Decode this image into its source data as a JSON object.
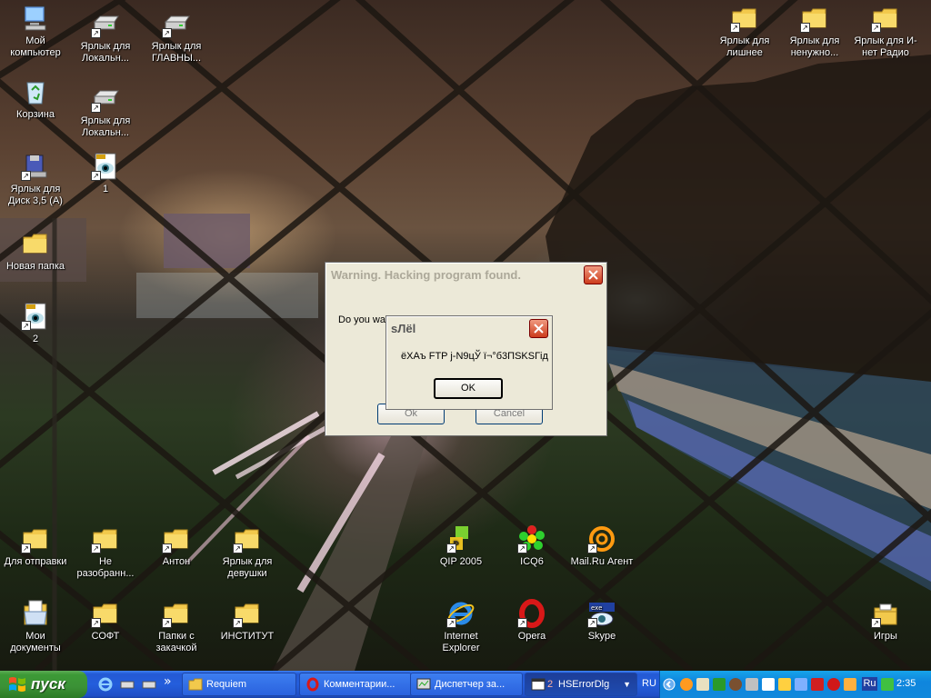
{
  "desktop": {
    "icons": [
      {
        "id": "my-computer",
        "label": "Мой компьютер",
        "icon": "my-computer-icon"
      },
      {
        "id": "local-shortcut-1",
        "label": "Ярлык для Локальн...",
        "icon": "drive-icon"
      },
      {
        "id": "main-shortcut",
        "label": "Ярлык для ГЛАВНЫ...",
        "icon": "drive-icon"
      },
      {
        "id": "recycle-bin",
        "label": "Корзина",
        "icon": "recycle-bin-icon"
      },
      {
        "id": "local-shortcut-2",
        "label": "Ярлык для Локальн...",
        "icon": "drive-icon"
      },
      {
        "id": "floppy-shortcut",
        "label": "Ярлык для Диск 3,5 (A)",
        "icon": "floppy-icon"
      },
      {
        "id": "image-1",
        "label": "1",
        "icon": "image-file-icon"
      },
      {
        "id": "new-folder",
        "label": "Новая папка",
        "icon": "folder-icon"
      },
      {
        "id": "image-2",
        "label": "2",
        "icon": "image-file-icon"
      },
      {
        "id": "shortcut-extra",
        "label": "Ярлык для лишнее",
        "icon": "folder-icon"
      },
      {
        "id": "shortcut-unneeded",
        "label": "Ярлык для ненужно...",
        "icon": "folder-icon"
      },
      {
        "id": "shortcut-radio",
        "label": "Ярлык для И-нет Радио",
        "icon": "folder-icon"
      },
      {
        "id": "for-sending",
        "label": "Для отправки",
        "icon": "folder-icon"
      },
      {
        "id": "unsorted",
        "label": "Не разобранн...",
        "icon": "folder-icon"
      },
      {
        "id": "anton",
        "label": "Антон",
        "icon": "folder-icon"
      },
      {
        "id": "for-girls",
        "label": "Ярлык для девушки",
        "icon": "folder-icon"
      },
      {
        "id": "qip",
        "label": "QIP 2005",
        "icon": "qip-icon"
      },
      {
        "id": "icq",
        "label": "ICQ6",
        "icon": "icq-flower-icon"
      },
      {
        "id": "mailru",
        "label": "Mail.Ru Агент",
        "icon": "mail-agent-icon"
      },
      {
        "id": "my-documents",
        "label": "Мои документы",
        "icon": "my-documents-icon"
      },
      {
        "id": "soft",
        "label": "СОФТ",
        "icon": "folder-icon"
      },
      {
        "id": "download-folders",
        "label": "Папки с закачкой",
        "icon": "folder-icon"
      },
      {
        "id": "institute",
        "label": "ИНСТИТУТ",
        "icon": "folder-icon"
      },
      {
        "id": "ie",
        "label": "Internet Explorer",
        "icon": "internet-explorer-icon"
      },
      {
        "id": "opera",
        "label": "Opera",
        "icon": "opera-icon"
      },
      {
        "id": "skype",
        "label": "Skype",
        "icon": "skype-icon"
      },
      {
        "id": "games",
        "label": "Игры",
        "icon": "games-icon"
      }
    ]
  },
  "warning_dialog": {
    "title": "Warning. Hacking program found.",
    "message": "Do you wa",
    "ok_label": "Ok",
    "cancel_label": "Cancel"
  },
  "error_dialog": {
    "title": "sЛёl",
    "message": "ёХАъ FTP ј-N9цЎ ї¬°б3ПSKSГiд",
    "ok_label": "OK"
  },
  "taskbar": {
    "start_label": "пуск",
    "tasks": [
      {
        "label": "Requiem",
        "icon": "folder-icon",
        "active": false
      },
      {
        "label": "Комментарии...",
        "icon": "opera-icon",
        "active": false
      },
      {
        "label": "Диспетчер за...",
        "icon": "task-manager-icon",
        "active": false
      },
      {
        "label": "HSErrorDlg",
        "count": "2",
        "icon": "app-window-icon",
        "active": true
      }
    ],
    "quick_launch_more": "»",
    "language": "RU",
    "tray_language": "Ru",
    "clock": "2:35"
  },
  "colors": {
    "xp_blue": "#245edc",
    "start_green": "#3c9a36",
    "dialog_face": "#ece9d8",
    "dialog_title_text": "#aca899",
    "close_red": "#cc3c1c"
  }
}
